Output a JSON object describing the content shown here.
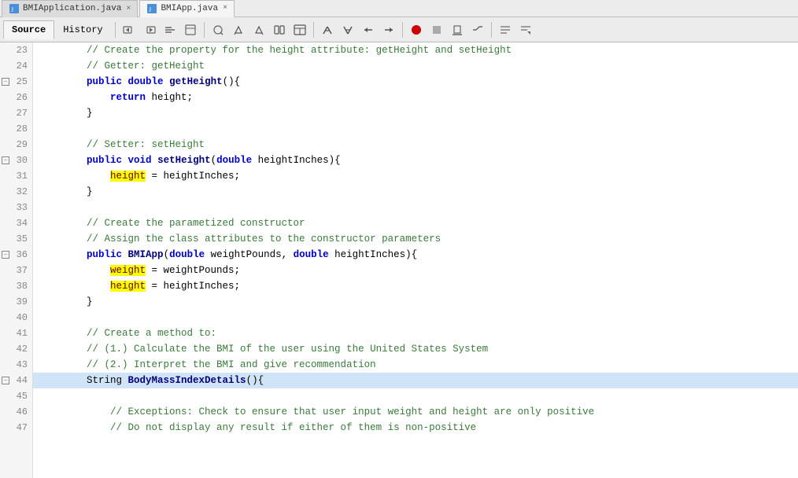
{
  "tabs": [
    {
      "label": "BMIApplication.java",
      "active": false,
      "icon": "java"
    },
    {
      "label": "BMIApp.java",
      "active": true,
      "icon": "java"
    }
  ],
  "toolbar": {
    "source_tab": "Source",
    "history_tab": "History"
  },
  "lines": [
    {
      "num": 23,
      "fold": false,
      "tokens": [
        {
          "t": "comment",
          "v": "        // Create the property for the height attribute: getHeight and setHeight"
        }
      ]
    },
    {
      "num": 24,
      "fold": false,
      "tokens": [
        {
          "t": "comment",
          "v": "        // Getter: getHeight"
        }
      ]
    },
    {
      "num": 25,
      "fold": true,
      "tokens": [
        {
          "t": "plain",
          "v": "        "
        },
        {
          "t": "kw",
          "v": "public"
        },
        {
          "t": "plain",
          "v": " "
        },
        {
          "t": "kw",
          "v": "double"
        },
        {
          "t": "plain",
          "v": " "
        },
        {
          "t": "bold-method",
          "v": "getHeight"
        },
        {
          "t": "plain",
          "v": "(){"
        }
      ]
    },
    {
      "num": 26,
      "fold": false,
      "tokens": [
        {
          "t": "plain",
          "v": "            "
        },
        {
          "t": "kw",
          "v": "return"
        },
        {
          "t": "plain",
          "v": " height;"
        }
      ]
    },
    {
      "num": 27,
      "fold": false,
      "tokens": [
        {
          "t": "plain",
          "v": "        }"
        }
      ]
    },
    {
      "num": 28,
      "fold": false,
      "tokens": []
    },
    {
      "num": 29,
      "fold": false,
      "tokens": [
        {
          "t": "comment",
          "v": "        // Setter: setHeight"
        }
      ]
    },
    {
      "num": 30,
      "fold": true,
      "tokens": [
        {
          "t": "plain",
          "v": "        "
        },
        {
          "t": "kw",
          "v": "public"
        },
        {
          "t": "plain",
          "v": " "
        },
        {
          "t": "kw",
          "v": "void"
        },
        {
          "t": "plain",
          "v": " "
        },
        {
          "t": "bold-method",
          "v": "setHeight"
        },
        {
          "t": "plain",
          "v": "("
        },
        {
          "t": "kw",
          "v": "double"
        },
        {
          "t": "plain",
          "v": " heightInches){"
        }
      ]
    },
    {
      "num": 31,
      "fold": false,
      "tokens": [
        {
          "t": "highlight",
          "v": "            "
        },
        {
          "t": "var",
          "v": "height"
        },
        {
          "t": "plain",
          "v": " = heightInches;"
        }
      ]
    },
    {
      "num": 32,
      "fold": false,
      "tokens": [
        {
          "t": "plain",
          "v": "        }"
        }
      ]
    },
    {
      "num": 33,
      "fold": false,
      "tokens": []
    },
    {
      "num": 34,
      "fold": false,
      "tokens": [
        {
          "t": "comment",
          "v": "        // Create the parametized constructor"
        }
      ]
    },
    {
      "num": 35,
      "fold": false,
      "tokens": [
        {
          "t": "comment",
          "v": "        // Assign the class attributes to the constructor parameters"
        }
      ]
    },
    {
      "num": 36,
      "fold": true,
      "tokens": [
        {
          "t": "plain",
          "v": "        "
        },
        {
          "t": "kw",
          "v": "public"
        },
        {
          "t": "plain",
          "v": " "
        },
        {
          "t": "bold-method",
          "v": "BMIApp"
        },
        {
          "t": "plain",
          "v": "("
        },
        {
          "t": "kw",
          "v": "double"
        },
        {
          "t": "plain",
          "v": " weightPounds, "
        },
        {
          "t": "kw",
          "v": "double"
        },
        {
          "t": "plain",
          "v": " heightInches){"
        }
      ]
    },
    {
      "num": 37,
      "fold": false,
      "tokens": [
        {
          "t": "plain",
          "v": "            "
        },
        {
          "t": "var",
          "v": "weight"
        },
        {
          "t": "plain",
          "v": " = weightPounds;"
        }
      ]
    },
    {
      "num": 38,
      "fold": false,
      "tokens": [
        {
          "t": "highlight",
          "v": "            "
        },
        {
          "t": "var",
          "v": "height"
        },
        {
          "t": "plain",
          "v": " = heightInches;"
        }
      ]
    },
    {
      "num": 39,
      "fold": false,
      "tokens": [
        {
          "t": "plain",
          "v": "        }"
        }
      ]
    },
    {
      "num": 40,
      "fold": false,
      "tokens": []
    },
    {
      "num": 41,
      "fold": false,
      "tokens": [
        {
          "t": "comment",
          "v": "        // Create a method to:"
        }
      ]
    },
    {
      "num": 42,
      "fold": false,
      "tokens": [
        {
          "t": "comment",
          "v": "        // (1.) Calculate the BMI of the user using the United States System"
        }
      ]
    },
    {
      "num": 43,
      "fold": false,
      "tokens": [
        {
          "t": "comment",
          "v": "        // (2.) Interpret the BMI and give recommendation"
        }
      ]
    },
    {
      "num": 44,
      "fold": true,
      "highlight": true,
      "tokens": [
        {
          "t": "plain",
          "v": "        String "
        },
        {
          "t": "bold-method",
          "v": "BodyMassIndexDetails"
        },
        {
          "t": "plain",
          "v": "(){"
        }
      ]
    },
    {
      "num": 45,
      "fold": false,
      "tokens": []
    },
    {
      "num": 46,
      "fold": false,
      "tokens": [
        {
          "t": "comment",
          "v": "            // Exceptions: Check to ensure that user input weight and height are only positive"
        }
      ]
    },
    {
      "num": 47,
      "fold": false,
      "tokens": [
        {
          "t": "comment",
          "v": "            // Do not display any result if either of them is non-positive"
        }
      ]
    }
  ]
}
